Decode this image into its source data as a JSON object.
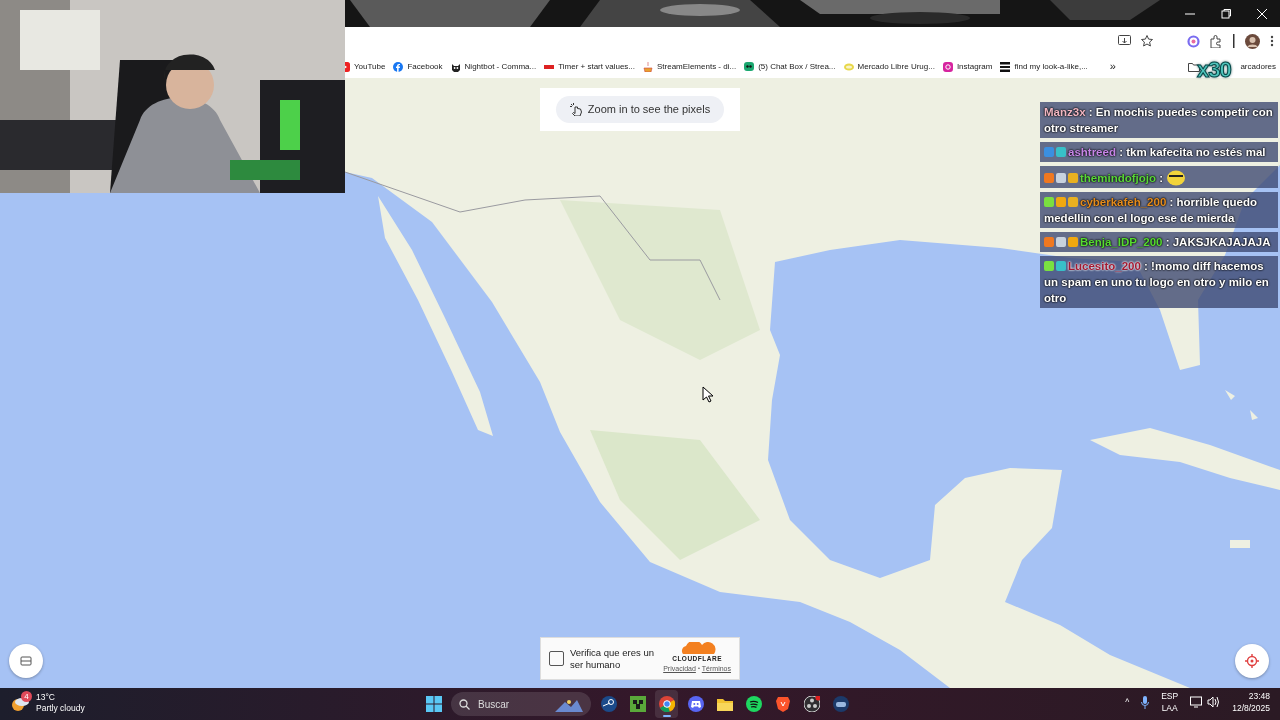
{
  "browser": {
    "bookmarks": [
      {
        "label": "YouTube",
        "kind": "youtube"
      },
      {
        "label": "Facebook",
        "kind": "facebook"
      },
      {
        "label": "Nightbot - Comma...",
        "kind": "bot"
      },
      {
        "label": "Timer + start values...",
        "kind": "timer"
      },
      {
        "label": "StreamElements - di...",
        "kind": "stream"
      },
      {
        "label": "(5) Chat Box / Strea...",
        "kind": "chat"
      },
      {
        "label": "Mercado Libre Urug...",
        "kind": "market"
      },
      {
        "label": "Instagram",
        "kind": "instagram"
      },
      {
        "label": "find my look-a-like,...",
        "kind": "bars"
      }
    ],
    "more": "»",
    "folder": "arcadores"
  },
  "overlay": {
    "multiplier": "x30"
  },
  "map": {
    "kind": "picture",
    "zoom_hint": "Zoom in to see the pixels"
  },
  "chat": [
    {
      "user": "Manz3x",
      "color": "#f2b6c2",
      "text": ": En mochis puedes competir con otro streamer"
    },
    {
      "user": "ashtreed",
      "color": "#c684e6",
      "text": ": tkm kafecita no estés mal",
      "badges": [
        {
          "kind": "tool"
        },
        {
          "kind": "chat"
        }
      ]
    },
    {
      "user": "themindofjojo",
      "color": "#5ad63a",
      "text": ":",
      "emote": true,
      "badges": [
        {
          "kind": "cube"
        },
        {
          "kind": "robot"
        },
        {
          "kind": "crown"
        }
      ]
    },
    {
      "user": "cyberkafeh_200",
      "color": "#e58c1c",
      "text": ": horrible quedo medellin con el logo ese de mierda",
      "badges": [
        {
          "kind": "gem"
        },
        {
          "kind": "coin"
        },
        {
          "kind": "crown"
        }
      ]
    },
    {
      "user": "Benja_IDP_200",
      "color": "#56da30",
      "text": ": JAKSJKAJAJAJA",
      "badges": [
        {
          "kind": "cube"
        },
        {
          "kind": "robot"
        },
        {
          "kind": "coin"
        }
      ]
    },
    {
      "user": "Lucesito_200",
      "color": "#a21a32",
      "text": ": !momo diff hacemos un spam en uno tu logo en otro y milo en otro",
      "badges": [
        {
          "kind": "gem"
        },
        {
          "kind": "chat"
        }
      ]
    }
  ],
  "captcha": {
    "label": "Verifica que eres un ser humano",
    "checked": false,
    "brand": "CLOUDFLARE",
    "links": [
      "Privacidad",
      "Términos"
    ],
    "separator": "•"
  },
  "taskbar": {
    "weather": {
      "temp": "13°C",
      "desc": "Partly cloudy",
      "badge": "4"
    },
    "search_placeholder": "Buscar",
    "apps": [
      {
        "kind": "steam",
        "active": false
      },
      {
        "kind": "minecraft",
        "active": false
      },
      {
        "kind": "chrome",
        "active": true
      },
      {
        "kind": "discord",
        "active": false
      },
      {
        "kind": "files",
        "active": false
      },
      {
        "kind": "spotify",
        "active": false
      },
      {
        "kind": "brave",
        "active": false
      },
      {
        "kind": "obs",
        "active": false
      },
      {
        "kind": "vr",
        "active": false
      }
    ],
    "tray_arrow": "^",
    "lang": [
      "ESP",
      "LAA"
    ],
    "time": "23:48",
    "date": "12/8/2025"
  }
}
